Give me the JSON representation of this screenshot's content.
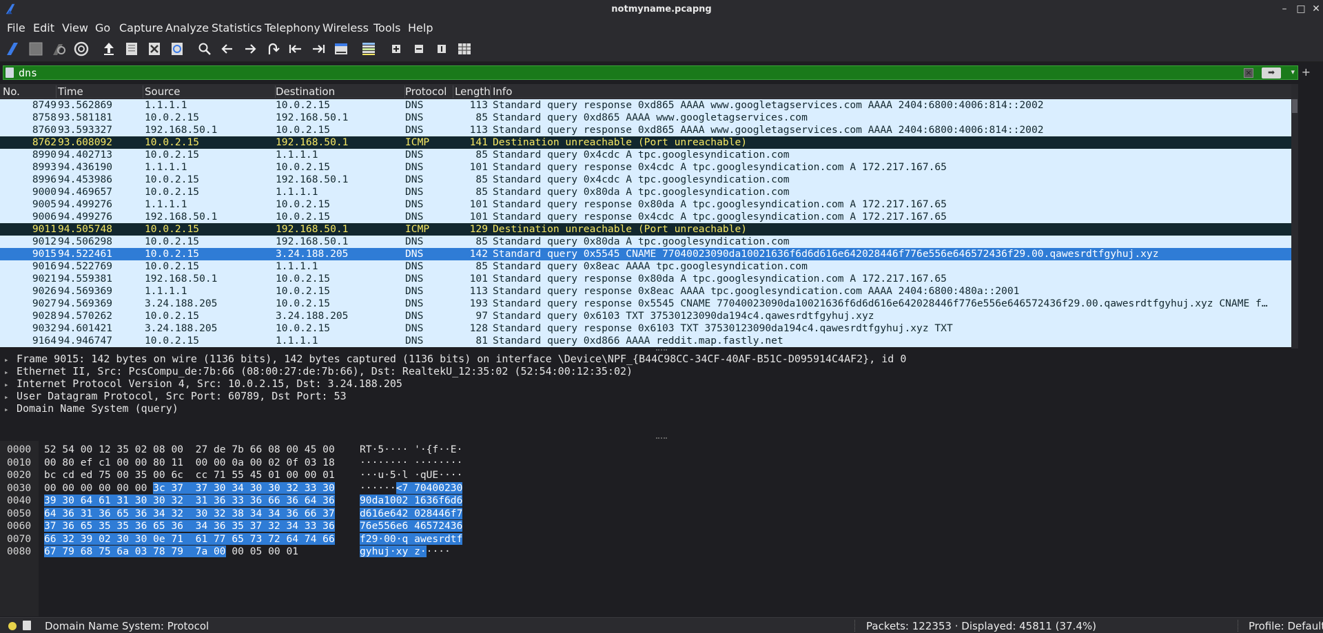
{
  "window": {
    "title": "notmyname.pcapng",
    "minimize": "–",
    "maximize": "□",
    "close": "✕"
  },
  "menu": [
    "File",
    "Edit",
    "View",
    "Go",
    "Capture",
    "Analyze",
    "Statistics",
    "Telephony",
    "Wireless",
    "Tools",
    "Help"
  ],
  "toolbar": {
    "icons": [
      "start-capture-icon",
      "stop-capture-icon",
      "restart-capture-icon",
      "capture-options-icon",
      "open-file-icon",
      "save-file-icon",
      "close-file-icon",
      "reload-file-icon",
      "find-packet-icon",
      "go-back-icon",
      "go-forward-icon",
      "go-to-packet-icon",
      "go-first-packet-icon",
      "go-last-packet-icon",
      "auto-scroll-icon",
      "colorize-icon",
      "zoom-in-icon",
      "zoom-out-icon",
      "normal-size-icon",
      "resize-columns-icon"
    ]
  },
  "filter": {
    "value": "dns",
    "bookmark_icon": "bookmark-icon",
    "clear_icon": "clear-icon",
    "apply_icon": "apply-arrow-icon",
    "add_button": "+"
  },
  "packet_list": {
    "columns": [
      "No.",
      "Time",
      "Source",
      "Destination",
      "Protocol",
      "Length",
      "Info"
    ],
    "rows": [
      {
        "no": "8749",
        "time": "93.562869",
        "src": "1.1.1.1",
        "dst": "10.0.2.15",
        "proto": "DNS",
        "len": "113",
        "info": "Standard query response 0xd865 AAAA www.googletagservices.com AAAA 2404:6800:4006:814::2002",
        "style": "dns"
      },
      {
        "no": "8758",
        "time": "93.581181",
        "src": "10.0.2.15",
        "dst": "192.168.50.1",
        "proto": "DNS",
        "len": "85",
        "info": "Standard query 0xd865 AAAA www.googletagservices.com",
        "style": "dns"
      },
      {
        "no": "8760",
        "time": "93.593327",
        "src": "192.168.50.1",
        "dst": "10.0.2.15",
        "proto": "DNS",
        "len": "113",
        "info": "Standard query response 0xd865 AAAA www.googletagservices.com AAAA 2404:6800:4006:814::2002",
        "style": "dns"
      },
      {
        "no": "8762",
        "time": "93.608092",
        "src": "10.0.2.15",
        "dst": "192.168.50.1",
        "proto": "ICMP",
        "len": "141",
        "info": "Destination unreachable (Port unreachable)",
        "style": "icmp"
      },
      {
        "no": "8990",
        "time": "94.402713",
        "src": "10.0.2.15",
        "dst": "1.1.1.1",
        "proto": "DNS",
        "len": "85",
        "info": "Standard query 0x4cdc A tpc.googlesyndication.com",
        "style": "dns"
      },
      {
        "no": "8993",
        "time": "94.436190",
        "src": "1.1.1.1",
        "dst": "10.0.2.15",
        "proto": "DNS",
        "len": "101",
        "info": "Standard query response 0x4cdc A tpc.googlesyndication.com A 172.217.167.65",
        "style": "dns"
      },
      {
        "no": "8996",
        "time": "94.453986",
        "src": "10.0.2.15",
        "dst": "192.168.50.1",
        "proto": "DNS",
        "len": "85",
        "info": "Standard query 0x4cdc A tpc.googlesyndication.com",
        "style": "dns"
      },
      {
        "no": "9000",
        "time": "94.469657",
        "src": "10.0.2.15",
        "dst": "1.1.1.1",
        "proto": "DNS",
        "len": "85",
        "info": "Standard query 0x80da A tpc.googlesyndication.com",
        "style": "dns"
      },
      {
        "no": "9005",
        "time": "94.499276",
        "src": "1.1.1.1",
        "dst": "10.0.2.15",
        "proto": "DNS",
        "len": "101",
        "info": "Standard query response 0x80da A tpc.googlesyndication.com A 172.217.167.65",
        "style": "dns"
      },
      {
        "no": "9006",
        "time": "94.499276",
        "src": "192.168.50.1",
        "dst": "10.0.2.15",
        "proto": "DNS",
        "len": "101",
        "info": "Standard query response 0x4cdc A tpc.googlesyndication.com A 172.217.167.65",
        "style": "dns"
      },
      {
        "no": "9011",
        "time": "94.505748",
        "src": "10.0.2.15",
        "dst": "192.168.50.1",
        "proto": "ICMP",
        "len": "129",
        "info": "Destination unreachable (Port unreachable)",
        "style": "icmp"
      },
      {
        "no": "9012",
        "time": "94.506298",
        "src": "10.0.2.15",
        "dst": "192.168.50.1",
        "proto": "DNS",
        "len": "85",
        "info": "Standard query 0x80da A tpc.googlesyndication.com",
        "style": "dns"
      },
      {
        "no": "9015",
        "time": "94.522461",
        "src": "10.0.2.15",
        "dst": "3.24.188.205",
        "proto": "DNS",
        "len": "142",
        "info": "Standard query 0x5545 CNAME 77040023090da10021636f6d6d616e642028446f776e556e646572436f29.00.qawesrdtfgyhuj.xyz",
        "style": "sel"
      },
      {
        "no": "9016",
        "time": "94.522769",
        "src": "10.0.2.15",
        "dst": "1.1.1.1",
        "proto": "DNS",
        "len": "85",
        "info": "Standard query 0x8eac AAAA tpc.googlesyndication.com",
        "style": "dns"
      },
      {
        "no": "9021",
        "time": "94.559381",
        "src": "192.168.50.1",
        "dst": "10.0.2.15",
        "proto": "DNS",
        "len": "101",
        "info": "Standard query response 0x80da A tpc.googlesyndication.com A 172.217.167.65",
        "style": "dns"
      },
      {
        "no": "9026",
        "time": "94.569369",
        "src": "1.1.1.1",
        "dst": "10.0.2.15",
        "proto": "DNS",
        "len": "113",
        "info": "Standard query response 0x8eac AAAA tpc.googlesyndication.com AAAA 2404:6800:480a::2001",
        "style": "dns"
      },
      {
        "no": "9027",
        "time": "94.569369",
        "src": "3.24.188.205",
        "dst": "10.0.2.15",
        "proto": "DNS",
        "len": "193",
        "info": "Standard query response 0x5545 CNAME 77040023090da10021636f6d6d616e642028446f776e556e646572436f29.00.qawesrdtfgyhuj.xyz CNAME f…",
        "style": "dns"
      },
      {
        "no": "9028",
        "time": "94.570262",
        "src": "10.0.2.15",
        "dst": "3.24.188.205",
        "proto": "DNS",
        "len": "97",
        "info": "Standard query 0x6103 TXT 37530123090da194c4.qawesrdtfgyhuj.xyz",
        "style": "dns"
      },
      {
        "no": "9032",
        "time": "94.601421",
        "src": "3.24.188.205",
        "dst": "10.0.2.15",
        "proto": "DNS",
        "len": "128",
        "info": "Standard query response 0x6103 TXT 37530123090da194c4.qawesrdtfgyhuj.xyz TXT",
        "style": "dns"
      },
      {
        "no": "9164",
        "time": "94.946747",
        "src": "10.0.2.15",
        "dst": "1.1.1.1",
        "proto": "DNS",
        "len": "81",
        "info": "Standard query 0xd866 AAAA reddit.map.fastly.net",
        "style": "dns"
      }
    ]
  },
  "details": [
    "Frame 9015: 142 bytes on wire (1136 bits), 142 bytes captured (1136 bits) on interface \\Device\\NPF_{B44C98CC-34CF-40AF-B51C-D095914C4AF2}, id 0",
    "Ethernet II, Src: PcsCompu_de:7b:66 (08:00:27:de:7b:66), Dst: RealtekU_12:35:02 (52:54:00:12:35:02)",
    "Internet Protocol Version 4, Src: 10.0.2.15, Dst: 3.24.188.205",
    "User Datagram Protocol, Src Port: 60789, Dst Port: 53",
    "Domain Name System (query)"
  ],
  "bytes": [
    {
      "off": "0000",
      "hex_pre": "52 54 00 12 35 02 08 00  27 de 7b 66 08 00 45 00",
      "hex_hl": "",
      "hex_post": "",
      "asc_pre": "RT·5···· '·{f··E·",
      "asc_hl": "",
      "asc_post": ""
    },
    {
      "off": "0010",
      "hex_pre": "00 80 ef c1 00 00 80 11  00 00 0a 00 02 0f 03 18",
      "hex_hl": "",
      "hex_post": "",
      "asc_pre": "········ ········",
      "asc_hl": "",
      "asc_post": ""
    },
    {
      "off": "0020",
      "hex_pre": "bc cd ed 75 00 35 00 6c  cc 71 55 45 01 00 00 01",
      "hex_hl": "",
      "hex_post": "",
      "asc_pre": "···u·5·l ·qUE····",
      "asc_hl": "",
      "asc_post": ""
    },
    {
      "off": "0030",
      "hex_pre": "00 00 00 00 00 00 ",
      "hex_hl": "3c 37  37 30 34 30 30 32 33 30",
      "hex_post": "",
      "asc_pre": "······",
      "asc_hl": "<7 70400230",
      "asc_post": ""
    },
    {
      "off": "0040",
      "hex_pre": "",
      "hex_hl": "39 30 64 61 31 30 30 32  31 36 33 36 66 36 64 36",
      "hex_post": "",
      "asc_pre": "",
      "asc_hl": "90da1002 1636f6d6",
      "asc_post": ""
    },
    {
      "off": "0050",
      "hex_pre": "",
      "hex_hl": "64 36 31 36 65 36 34 32  30 32 38 34 34 36 66 37",
      "hex_post": "",
      "asc_pre": "",
      "asc_hl": "d616e642 028446f7",
      "asc_post": ""
    },
    {
      "off": "0060",
      "hex_pre": "",
      "hex_hl": "37 36 65 35 35 36 65 36  34 36 35 37 32 34 33 36",
      "hex_post": "",
      "asc_pre": "",
      "asc_hl": "76e556e6 46572436",
      "asc_post": ""
    },
    {
      "off": "0070",
      "hex_pre": "",
      "hex_hl": "66 32 39 02 30 30 0e 71  61 77 65 73 72 64 74 66",
      "hex_post": "",
      "asc_pre": "",
      "asc_hl": "f29·00·q awesrdtf",
      "asc_post": ""
    },
    {
      "off": "0080",
      "hex_pre": "",
      "hex_hl": "67 79 68 75 6a 03 78 79  7a 00",
      "hex_post": " 00 05 00 01",
      "asc_pre": "",
      "asc_hl": "gyhuj·xy z·",
      "asc_post": "····"
    }
  ],
  "status": {
    "field": "Domain Name System: Protocol",
    "packets": "Packets: 122353 · Displayed: 45811 (37.4%)",
    "profile": "Profile: Default",
    "led_color": "#e7d24a"
  },
  "colors": {
    "dns_row": "#daeeff",
    "icmp_row": "#12272e",
    "icmp_text": "#f7e864",
    "selected_row": "#2f7cd6",
    "filter_valid": "#1a7a1a"
  }
}
